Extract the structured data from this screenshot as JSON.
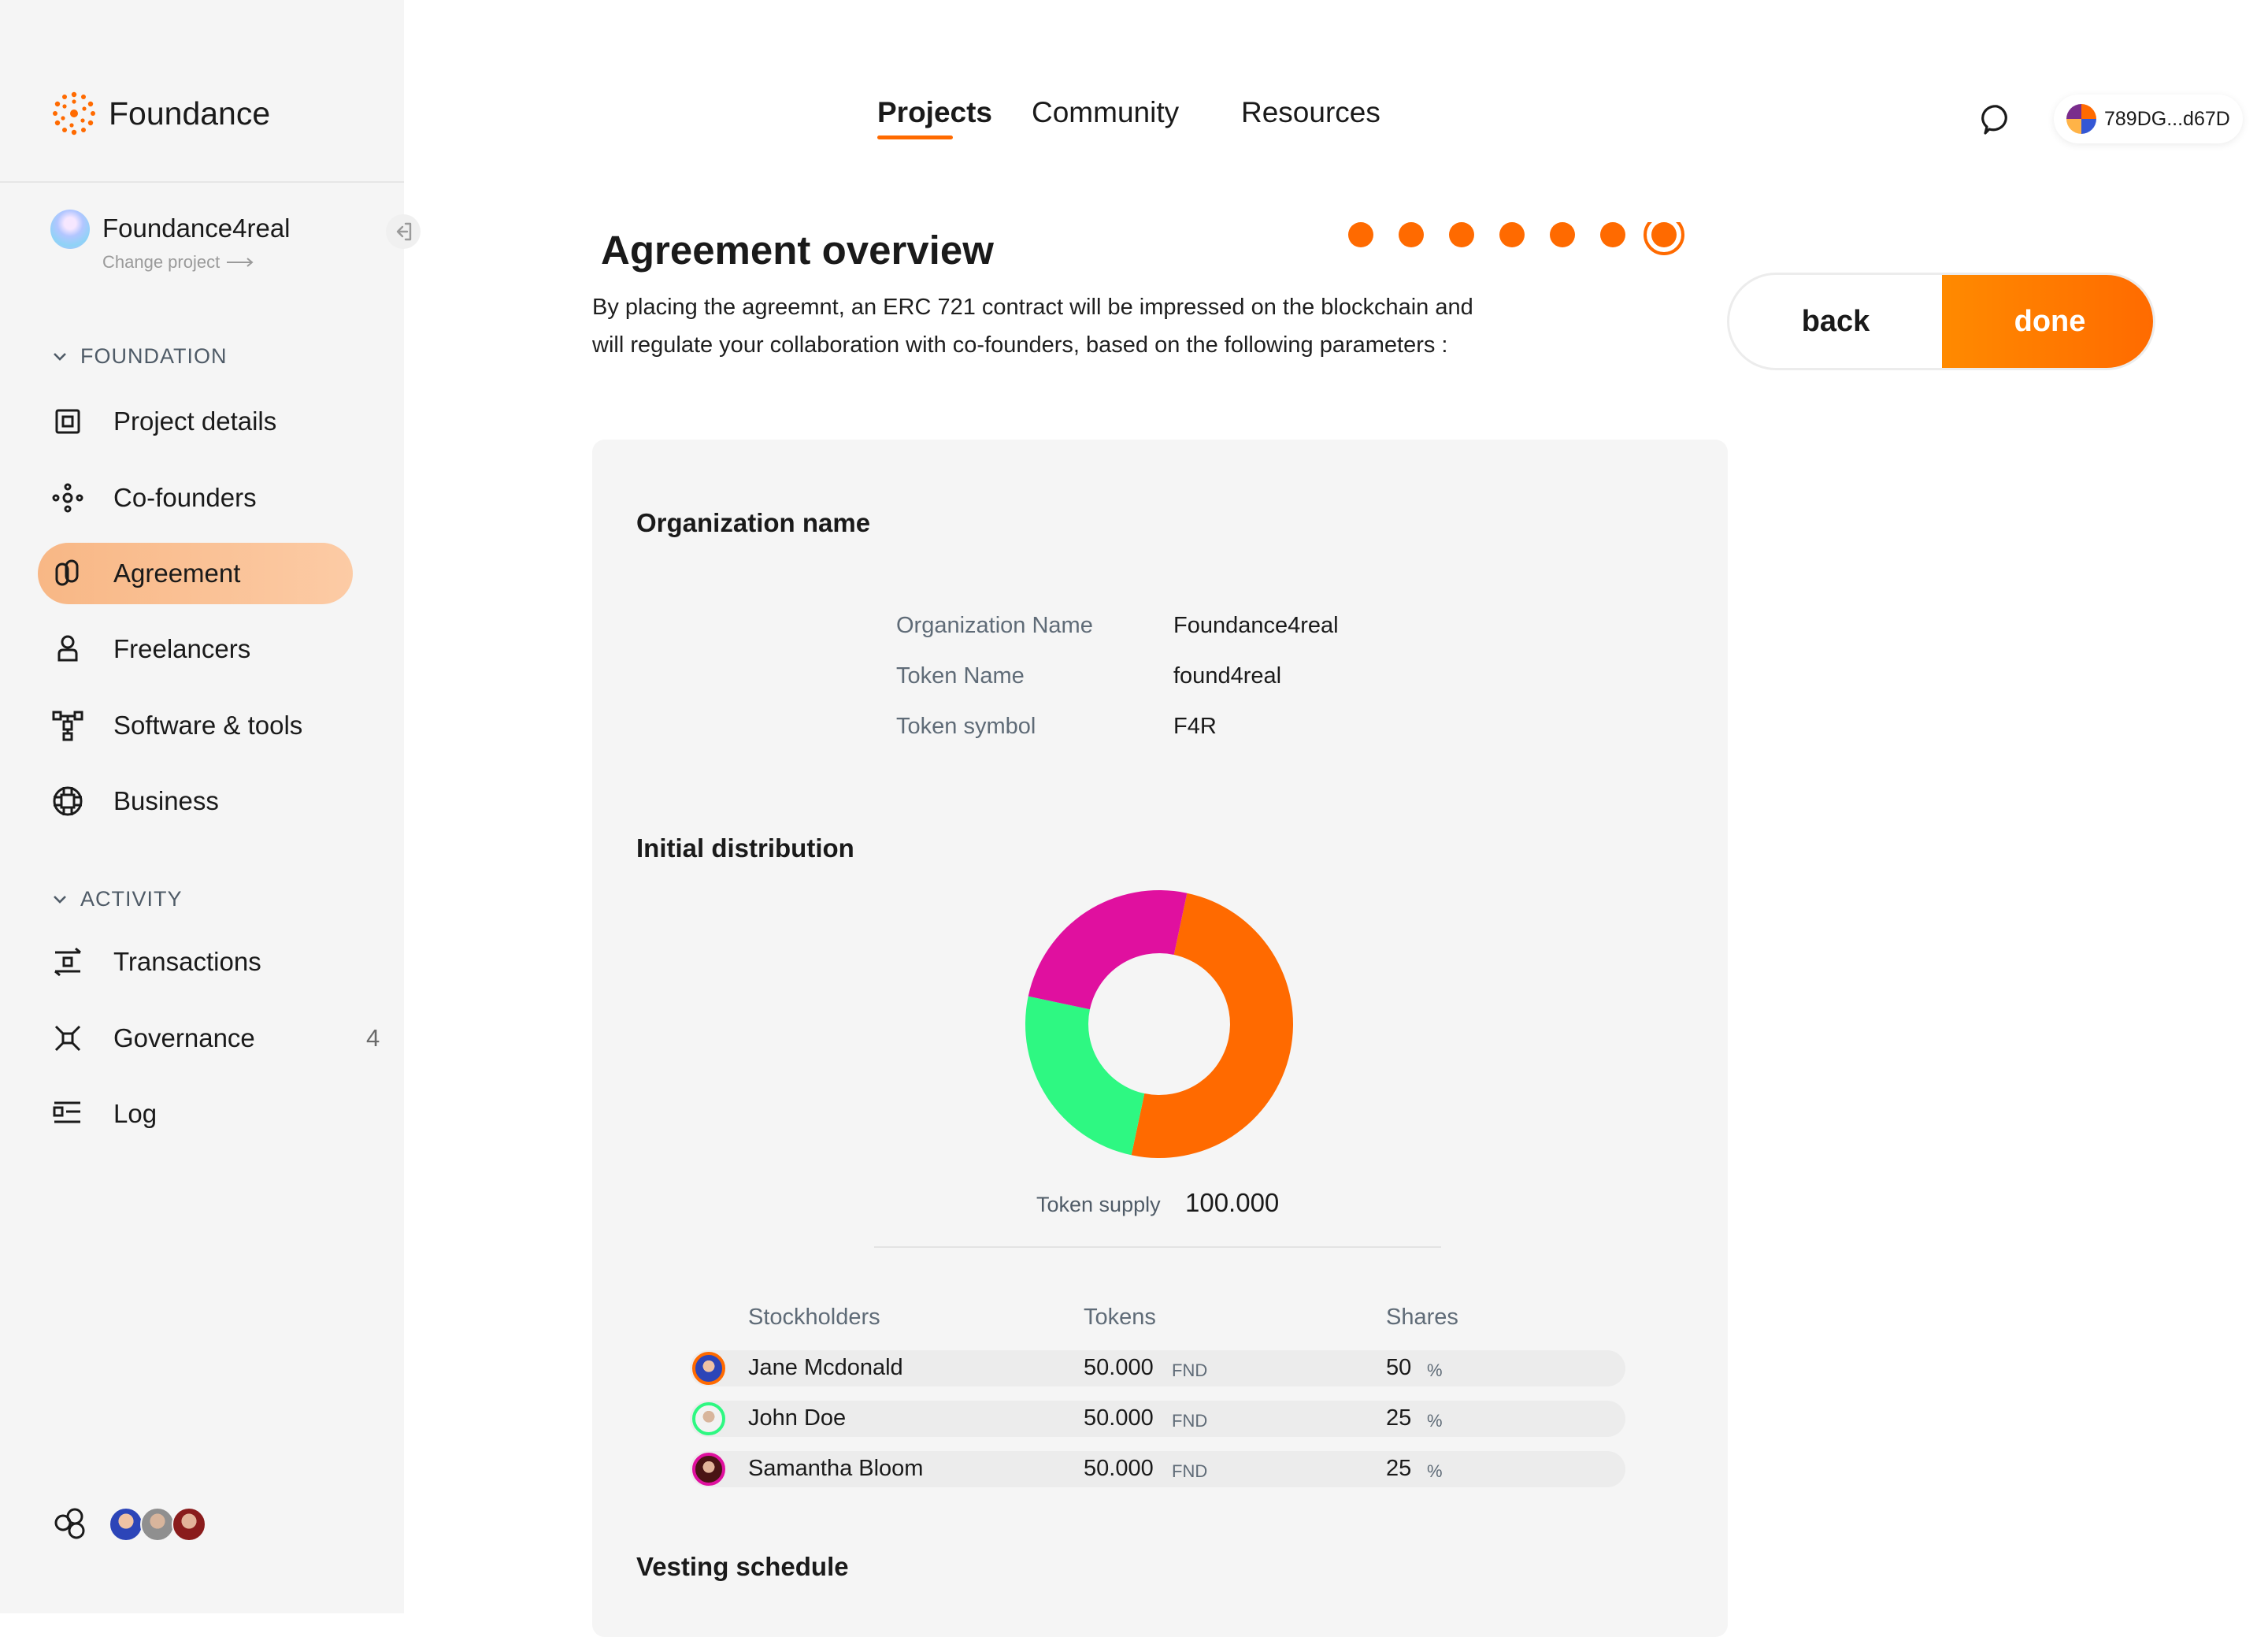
{
  "brand": {
    "name": "Foundance",
    "accent": "#ff6a00"
  },
  "project": {
    "name": "Foundance4real",
    "change_label": "Change project"
  },
  "sidebar": {
    "sections": [
      {
        "title": "FOUNDATION"
      },
      {
        "title": "ACTIVITY"
      }
    ],
    "foundation_items": [
      {
        "label": "Project details",
        "icon": "project-details-icon"
      },
      {
        "label": "Co-founders",
        "icon": "cofounders-icon"
      },
      {
        "label": "Agreement",
        "icon": "agreement-icon",
        "active": true
      },
      {
        "label": "Freelancers",
        "icon": "freelancers-icon"
      },
      {
        "label": "Software & tools",
        "icon": "software-tools-icon"
      },
      {
        "label": "Business",
        "icon": "business-icon"
      }
    ],
    "activity_items": [
      {
        "label": "Transactions",
        "icon": "transactions-icon"
      },
      {
        "label": "Governance",
        "icon": "governance-icon",
        "count": "4"
      },
      {
        "label": "Log",
        "icon": "log-icon"
      }
    ]
  },
  "topnav": {
    "tabs": [
      {
        "label": "Projects",
        "active": true
      },
      {
        "label": "Community"
      },
      {
        "label": "Resources"
      }
    ],
    "wallet": "789DG...d67D"
  },
  "page": {
    "title": "Agreement overview",
    "intro": "By placing the agreemnt, an ERC 721 contract will be impressed on the blockchain and will regulate your collaboration with co-founders, based on the following parameters :",
    "steps_total": 7,
    "steps_current": 7,
    "back_label": "back",
    "done_label": "done"
  },
  "org": {
    "heading": "Organization name",
    "fields": [
      {
        "label": "Organization Name",
        "value": "Foundance4real"
      },
      {
        "label": "Token Name",
        "value": "found4real"
      },
      {
        "label": "Token symbol",
        "value": "F4R"
      }
    ]
  },
  "distribution": {
    "heading": "Initial distribution",
    "supply_label": "Token supply",
    "supply_value": "100.000",
    "columns": [
      "Stockholders",
      "Tokens",
      "Shares"
    ],
    "unit": "FND",
    "pct": "%",
    "rows": [
      {
        "name": "Jane Mcdonald",
        "tokens": "50.000",
        "share": "50"
      },
      {
        "name": "John Doe",
        "tokens": "50.000",
        "share": "25"
      },
      {
        "name": "Samantha Bloom",
        "tokens": "50.000",
        "share": "25"
      }
    ]
  },
  "chart_data": {
    "type": "pie",
    "labels": [
      "Jane Mcdonald",
      "John Doe",
      "Samantha Bloom"
    ],
    "values": [
      50,
      25,
      25
    ],
    "colors": [
      "#ff6a00",
      "#2ef882",
      "#e0109f"
    ]
  },
  "vesting": {
    "heading": "Vesting schedule"
  }
}
